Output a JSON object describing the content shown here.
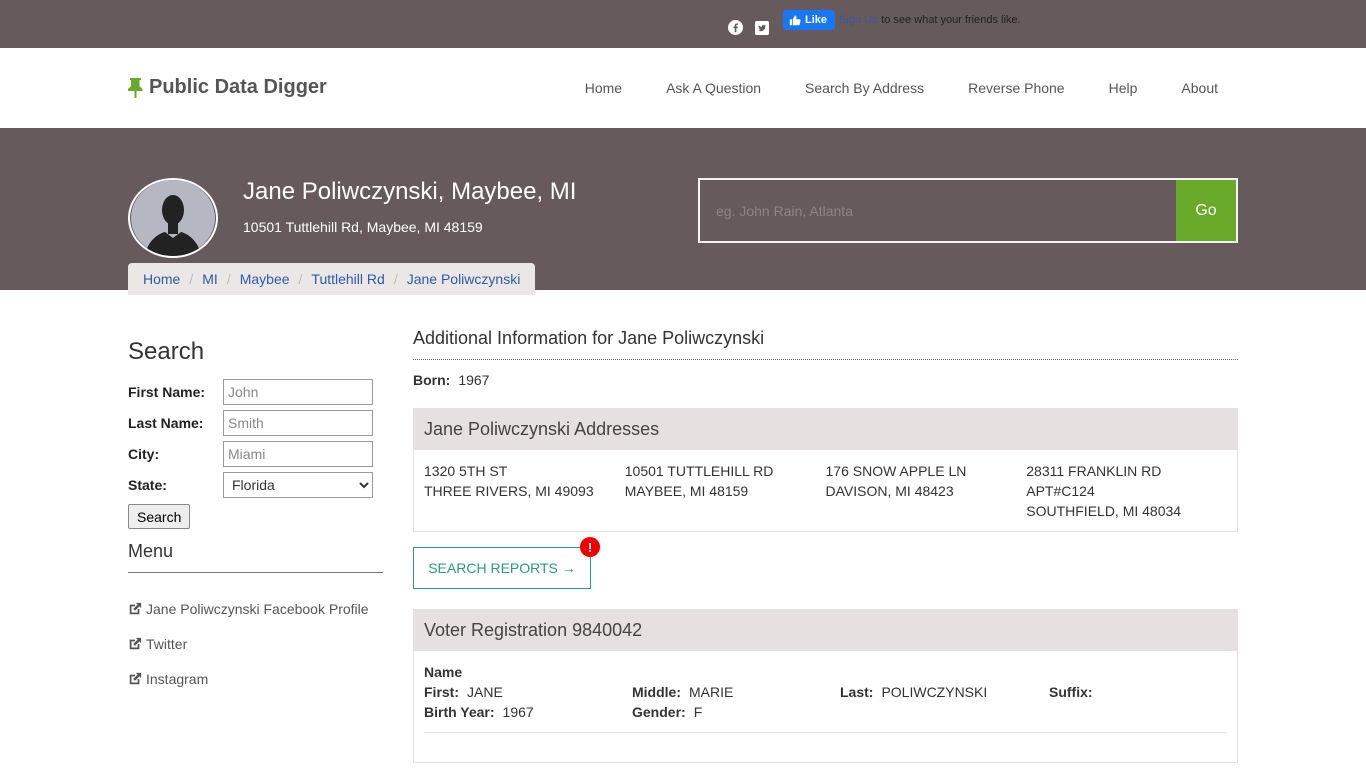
{
  "social": {
    "icons": [
      "facebook-icon",
      "twitter-icon"
    ],
    "fb_like_label": "Like",
    "fb_signup": "Sign Up",
    "fb_text": "to see what your friends like."
  },
  "nav": {
    "brand": "Public Data Digger",
    "links": [
      "Home",
      "Ask A Question",
      "Search By Address",
      "Reverse Phone",
      "Help",
      "About"
    ]
  },
  "hero": {
    "name": "Jane Poliwczynski, Maybee, MI",
    "address": "10501 Tuttlehill Rd, Maybee, MI 48159",
    "search_placeholder": "eg. John Rain, Atlanta",
    "go_label": "Go"
  },
  "breadcrumb": [
    "Home",
    "MI",
    "Maybee",
    "Tuttlehill Rd",
    "Jane Poliwczynski"
  ],
  "sidebar": {
    "title": "Search",
    "fields": [
      {
        "label": "First Name:",
        "placeholder": "John"
      },
      {
        "label": "Last Name:",
        "placeholder": "Smith"
      },
      {
        "label": "City:",
        "placeholder": "Miami"
      }
    ],
    "state_label": "State:",
    "state_value": "Florida",
    "search_button": "Search",
    "menu_title": "Menu",
    "menu_items": [
      "Jane Poliwczynski Facebook Profile",
      "Twitter",
      "Instagram"
    ]
  },
  "main": {
    "title": "Additional Information for Jane Poliwczynski",
    "born_label": "Born:",
    "born_value": "1967",
    "addresses_title": "Jane Poliwczynski Addresses",
    "addresses": [
      [
        "1320 5TH ST",
        "THREE RIVERS, MI 49093"
      ],
      [
        "10501 TUTTLEHILL RD",
        "MAYBEE, MI 48159"
      ],
      [
        "176 SNOW APPLE LN",
        "DAVISON, MI 48423"
      ],
      [
        "28311 FRANKLIN RD",
        "APT#C124",
        "SOUTHFIELD, MI 48034"
      ]
    ],
    "reports_button": "SEARCH REPORTS →",
    "alert_symbol": "!",
    "voter_title": "Voter Registration 9840042",
    "voter_name_heading": "Name",
    "voter": {
      "first_label": "First:",
      "first": "JANE",
      "middle_label": "Middle:",
      "middle": "MARIE",
      "last_label": "Last:",
      "last": "POLIWCZYNSKI",
      "suffix_label": "Suffix:",
      "suffix": "",
      "birth_label": "Birth Year:",
      "birth": "1967",
      "gender_label": "Gender:",
      "gender": "F"
    }
  },
  "colors": {
    "header_bg": "#675a5c",
    "accent_green": "#6aaa2a",
    "link_blue": "#2e5aa7",
    "reports_teal": "#2a9d78"
  }
}
